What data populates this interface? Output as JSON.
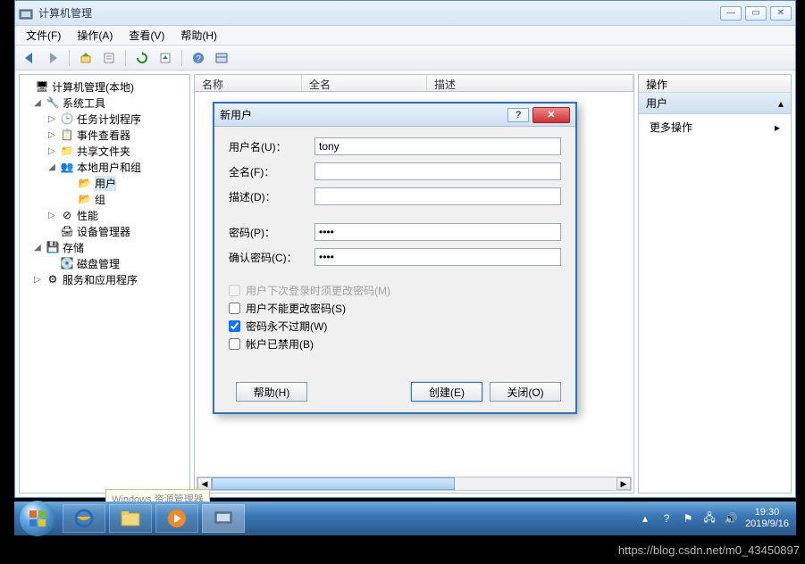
{
  "window": {
    "title": "计算机管理",
    "min": "—",
    "max": "▭",
    "close": "✕"
  },
  "menu": {
    "file": "文件(F)",
    "action": "操作(A)",
    "view": "查看(V)",
    "help": "帮助(H)"
  },
  "tree": {
    "root": "计算机管理(本地)",
    "systools": "系统工具",
    "task": "任务计划程序",
    "event": "事件查看器",
    "shared": "共享文件夹",
    "localusers": "本地用户和组",
    "users": "用户",
    "groups": "组",
    "perf": "性能",
    "devmgr": "设备管理器",
    "storage": "存储",
    "diskmgr": "磁盘管理",
    "services": "服务和应用程序"
  },
  "list_headers": {
    "name": "名称",
    "fullname": "全名",
    "desc": "描述"
  },
  "actions": {
    "header": "操作",
    "section": "用户",
    "more": "更多操作"
  },
  "dialog": {
    "title": "新用户",
    "username_label": "用户名(U)：",
    "username_value": "tony",
    "fullname_label": "全名(F)：",
    "fullname_value": "",
    "desc_label": "描述(D)：",
    "desc_value": "",
    "password_label": "密码(P)：",
    "password_value": "****",
    "confirm_label": "确认密码(C)：",
    "confirm_value": "****",
    "chk_mustchange": "用户下次登录时须更改密码(M)",
    "chk_cannotchange": "用户不能更改密码(S)",
    "chk_neverexpire": "密码永不过期(W)",
    "chk_disabled": "帐户已禁用(B)",
    "btn_help": "帮助(H)",
    "btn_create": "创建(E)",
    "btn_close": "关闭(O)",
    "help_sym": "?",
    "close_sym": "✕"
  },
  "taskbar": {
    "time": "19:30",
    "date": "2019/9/16"
  },
  "tooltip": "Windows 资源管理器",
  "watermark": "https://blog.csdn.net/m0_43450897"
}
